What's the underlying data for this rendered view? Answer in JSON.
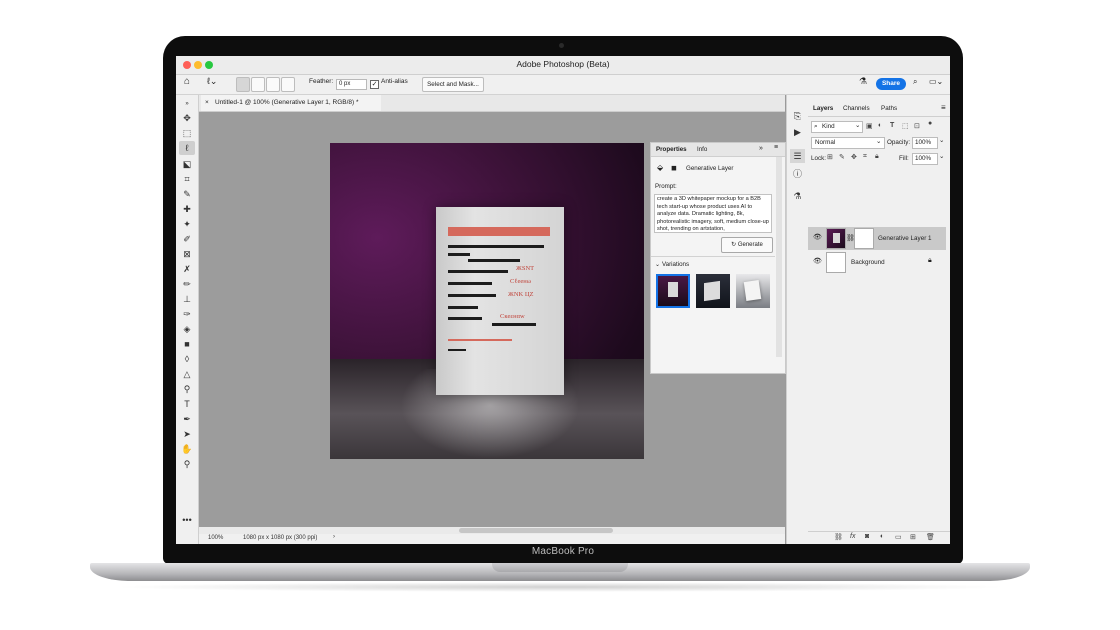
{
  "window": {
    "title": "Adobe Photoshop (Beta)",
    "device_label": "MacBook Pro"
  },
  "options_bar": {
    "feather_label": "Feather:",
    "feather_value": "0 px",
    "anti_alias_label": "Anti-alias",
    "select_mask_label": "Select and Mask...",
    "share_label": "Share"
  },
  "document": {
    "tab_title": "Untitled-1 @ 100% (Generative Layer 1, RGB/8) *",
    "zoom": "100%",
    "info": "1080 px x 1080 px (300 ppi)"
  },
  "artwork": {
    "red_lines": [
      "ЖЅNT",
      "Cℓeeнω",
      "ЖNK ЦZ",
      "Cкeεнαw"
    ]
  },
  "properties": {
    "tabs": [
      "Properties",
      "Info"
    ],
    "layer_type": "Generative Layer",
    "prompt_label": "Prompt:",
    "prompt_text": "create a 3D whitepaper mockup for a B2B tech start-up whose product uses AI to analyze data. Dramatic lighting, 8k, photorealistic imagery, soft, medium close-up shot, trending on artstation,",
    "generate_label": "Generate",
    "variations_label": "Variations"
  },
  "layers": {
    "tabs": [
      "Layers",
      "Channels",
      "Paths"
    ],
    "kind_label": "Kind",
    "blend_mode": "Normal",
    "opacity_label": "Opacity:",
    "opacity_value": "100%",
    "lock_label": "Lock:",
    "fill_label": "Fill:",
    "fill_value": "100%",
    "items": [
      {
        "name": "Generative Layer 1",
        "selected": true
      },
      {
        "name": "Background",
        "selected": false
      }
    ]
  }
}
